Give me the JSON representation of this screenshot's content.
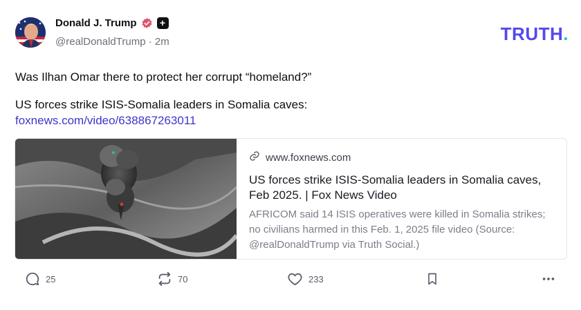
{
  "post": {
    "author_name": "Donald J. Trump",
    "handle": "@realDonaldTrump",
    "separator": "·",
    "time": "2m",
    "text_line1": "Was Ilhan Omar there to protect her corrupt “homeland?”",
    "text_line2": "US forces strike ISIS-Somalia leaders in Somalia caves:",
    "link_text": "foxnews.com/video/638867263011"
  },
  "brand": {
    "logo_text": "TRUTH",
    "logo_dot": ".",
    "accent": "#5448ee",
    "dot_color": "#1ec7b6"
  },
  "card": {
    "domain": "www.foxnews.com",
    "title": "US forces strike ISIS-Somalia leaders in Somalia caves, Feb 2025. | Fox News Video",
    "description": "AFRICOM said 14 ISIS operatives were killed in Somalia strikes; no civilians harmed in this Feb. 1, 2025 file video (Source: @realDonaldTrump via Truth Social.)"
  },
  "actions": {
    "replies": "25",
    "retruths": "70",
    "likes": "233"
  },
  "icons": [
    "verified-badge-icon",
    "plus-badge-icon",
    "link-icon",
    "reply-icon",
    "retruth-icon",
    "like-icon",
    "bookmark-icon",
    "more-icon"
  ]
}
